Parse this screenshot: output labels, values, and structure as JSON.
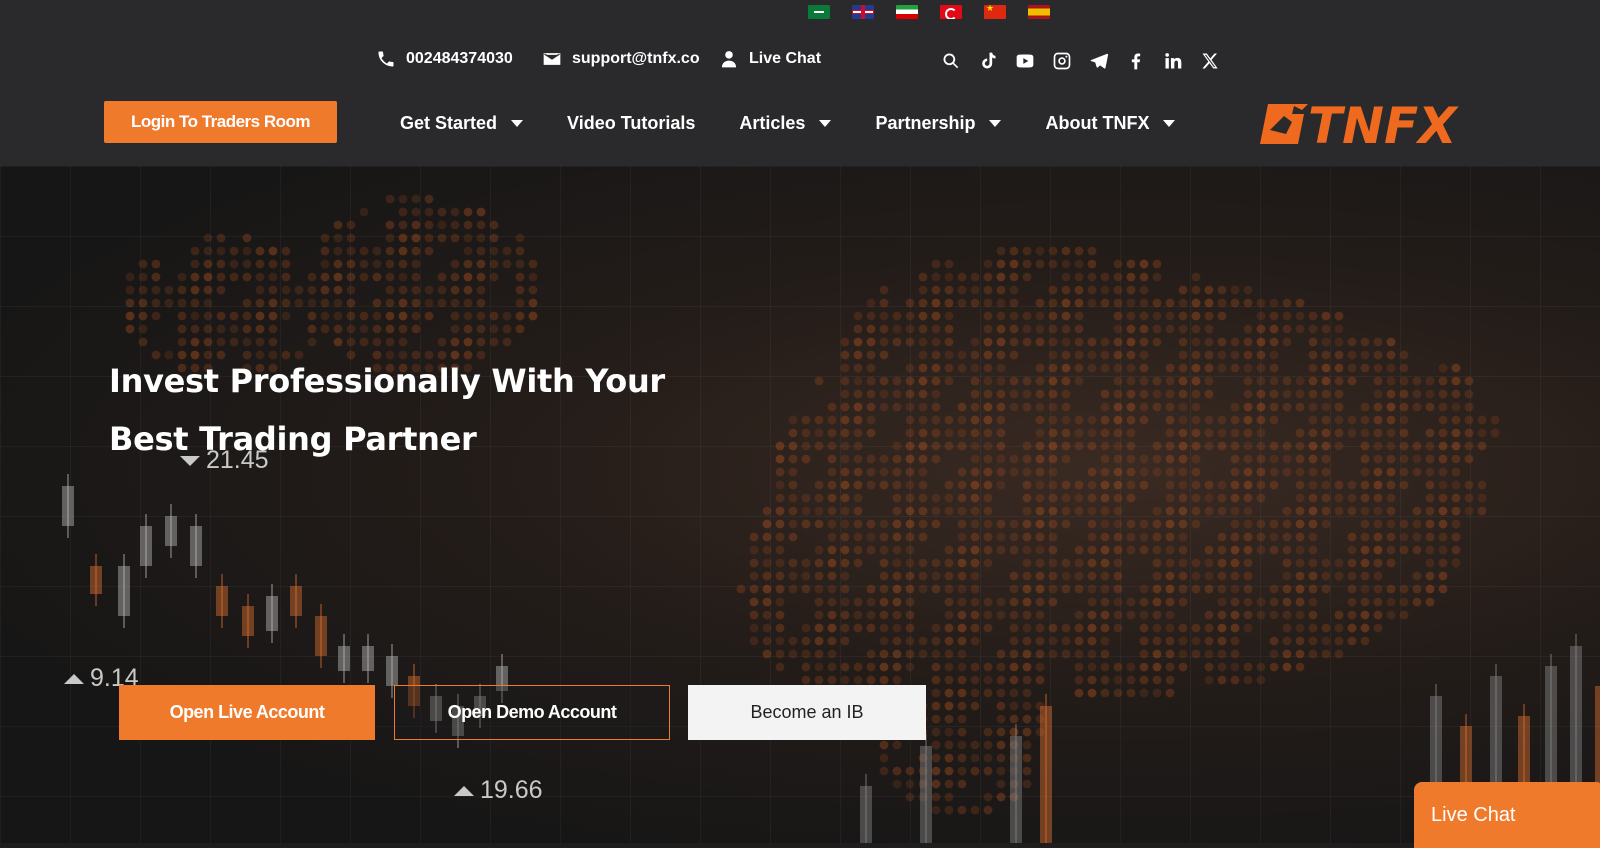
{
  "flags": [
    "Arabic",
    "English",
    "Persian",
    "Turkish",
    "Chinese",
    "Spanish"
  ],
  "contact": {
    "phone": "002484374030",
    "email": "support@tnfx.co",
    "chat": "Live Chat"
  },
  "social_icons": [
    "search-icon",
    "tiktok-icon",
    "youtube-icon",
    "instagram-icon",
    "telegram-icon",
    "facebook-icon",
    "linkedin-icon",
    "x-icon"
  ],
  "header": {
    "login_label": "Login To Traders Room",
    "logo_text": "TNFX"
  },
  "nav": {
    "items": [
      {
        "label": "Get Started",
        "dropdown": true
      },
      {
        "label": "Video Tutorials",
        "dropdown": false
      },
      {
        "label": "Articles",
        "dropdown": true
      },
      {
        "label": "Partnership",
        "dropdown": true
      },
      {
        "label": "About TNFX",
        "dropdown": true
      }
    ]
  },
  "hero": {
    "headline_line1": "Invest Professionally With Your",
    "headline_line2": "Best Trading Partner",
    "ticker_1": "21.45",
    "ticker_2": "9.14",
    "ticker_3": "19.66",
    "cta_live": "Open Live Account",
    "cta_demo": "Open Demo Account",
    "cta_ib": "Become an IB"
  },
  "widget": {
    "live_chat": "Live Chat"
  },
  "colors": {
    "accent": "#ef7a2c",
    "header_bg": "#2a2a2c",
    "hero_bg": "#1e1e1f"
  }
}
